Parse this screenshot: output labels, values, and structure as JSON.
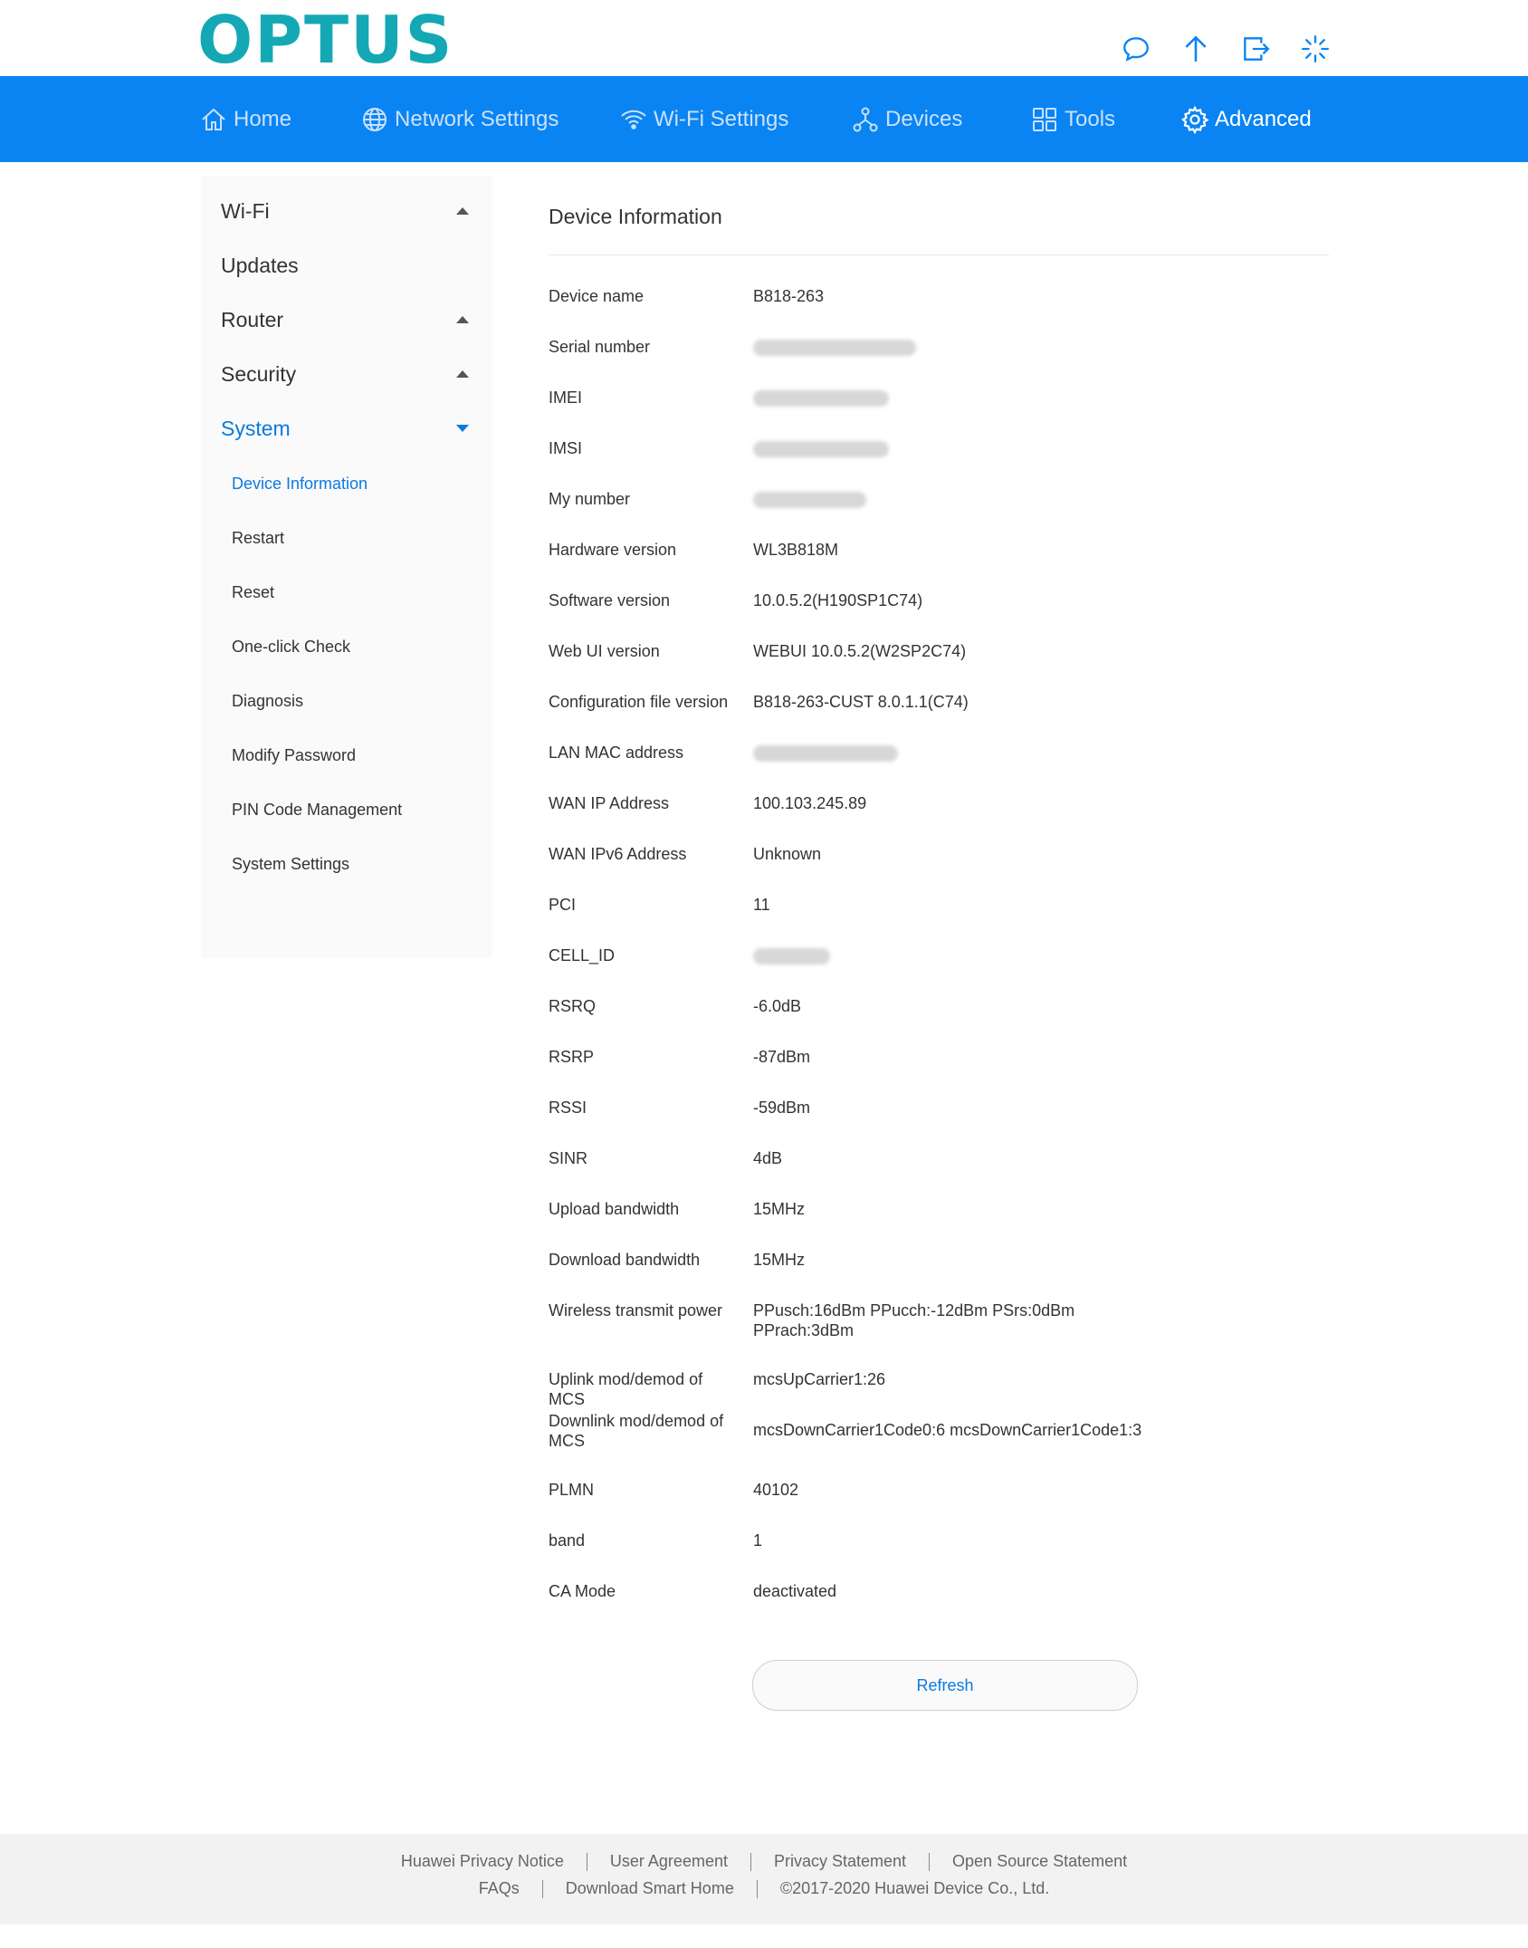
{
  "brand": {
    "logo_text": "OPTUS",
    "logo_color": "#14a8b5",
    "nav_color": "#0a84f3",
    "accent": "#0a7ae0"
  },
  "header_icons": [
    "chat-icon",
    "upload-arrow-icon",
    "logout-icon",
    "loading-spinner-icon"
  ],
  "nav": {
    "home": "Home",
    "network": "Network Settings",
    "wifi": "Wi-Fi Settings",
    "devices": "Devices",
    "tools": "Tools",
    "advanced": "Advanced"
  },
  "sidebar": {
    "wifi": "Wi-Fi",
    "updates": "Updates",
    "router": "Router",
    "security": "Security",
    "system": "System",
    "sub": {
      "device_info": "Device Information",
      "restart": "Restart",
      "reset": "Reset",
      "one_click": "One-click Check",
      "diagnosis": "Diagnosis",
      "modify_password": "Modify Password",
      "pin": "PIN Code Management",
      "system_settings": "System Settings"
    }
  },
  "main": {
    "title": "Device Information",
    "rows": [
      {
        "label": "Device name",
        "value": "B818-263"
      },
      {
        "label": "Serial number",
        "value": ""
      },
      {
        "label": "IMEI",
        "value": ""
      },
      {
        "label": "IMSI",
        "value": ""
      },
      {
        "label": "My number",
        "value": ""
      },
      {
        "label": "Hardware version",
        "value": "WL3B818M"
      },
      {
        "label": "Software version",
        "value": "10.0.5.2(H190SP1C74)"
      },
      {
        "label": "Web UI version",
        "value": "WEBUI 10.0.5.2(W2SP2C74)"
      },
      {
        "label": "Configuration file version",
        "value": "B818-263-CUST 8.0.1.1(C74)"
      },
      {
        "label": "LAN MAC address",
        "value": ""
      },
      {
        "label": "WAN IP Address",
        "value": "100.103.245.89"
      },
      {
        "label": "WAN IPv6 Address",
        "value": "Unknown"
      },
      {
        "label": "PCI",
        "value": "11"
      },
      {
        "label": "CELL_ID",
        "value": ""
      },
      {
        "label": "RSRQ",
        "value": "-6.0dB"
      },
      {
        "label": "RSRP",
        "value": "-87dBm"
      },
      {
        "label": "RSSI",
        "value": "-59dBm"
      },
      {
        "label": "SINR",
        "value": "4dB"
      },
      {
        "label": "Upload bandwidth",
        "value": "15MHz"
      },
      {
        "label": "Download bandwidth",
        "value": "15MHz"
      },
      {
        "label": "Wireless transmit power",
        "value": "PPusch:16dBm PPucch:-12dBm PSrs:0dBm PPrach:3dBm"
      },
      {
        "label": "Uplink mod/demod of MCS",
        "value": "mcsUpCarrier1:26"
      },
      {
        "label": "Downlink mod/demod of MCS",
        "value": "mcsDownCarrier1Code0:6 mcsDownCarrier1Code1:3"
      },
      {
        "label": "PLMN",
        "value": "40102"
      },
      {
        "label": "band",
        "value": "1"
      },
      {
        "label": "CA Mode",
        "value": "deactivated"
      }
    ],
    "refresh_label": "Refresh"
  },
  "footer": {
    "privacy_notice": "Huawei Privacy Notice",
    "user_agreement": "User Agreement",
    "privacy_statement": "Privacy Statement",
    "open_source": "Open Source Statement",
    "faqs": "FAQs",
    "smart_home": "Download Smart Home",
    "copyright": "©2017-2020 Huawei Device Co., Ltd."
  }
}
